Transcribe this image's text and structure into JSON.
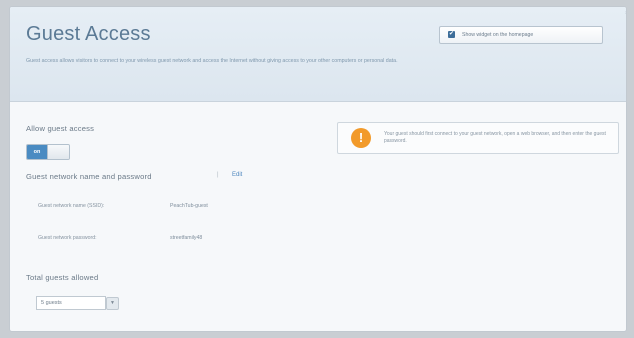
{
  "header": {
    "title": "Guest Access",
    "description": "Guest access allows visitors to connect to your wireless guest network and access the Internet without giving access to your other computers or personal data.",
    "widget_label": "Show widget on the homepage"
  },
  "allow_guest": {
    "label": "Allow guest access",
    "toggle_state": "on"
  },
  "network": {
    "label": "Guest network name and password",
    "separator": "|",
    "edit_label": "Edit",
    "ssid_label": "Guest network name (SSID):",
    "ssid_value": "PeachTub-guest",
    "password_label": "Guest network password:",
    "password_value": "streetfamily48"
  },
  "notice": {
    "text": "Your guest should first connect to your guest network, open a web browser, and then enter the guest password."
  },
  "total_guests": {
    "label": "Total guests allowed",
    "selected": "5 guests"
  },
  "colors": {
    "accent": "#4a8bc2",
    "warning": "#f29a2a",
    "title": "#5b7a95"
  }
}
